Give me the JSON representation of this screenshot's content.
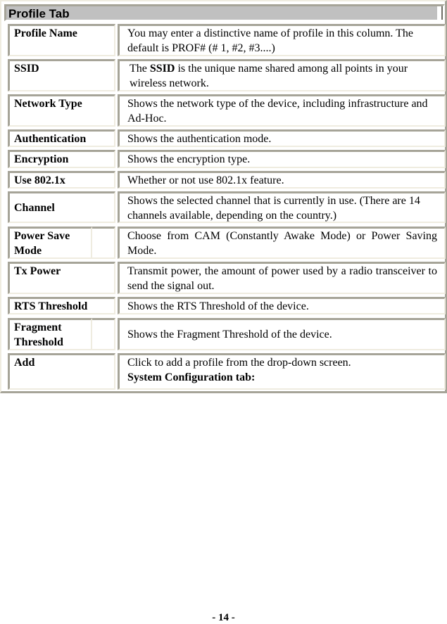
{
  "section_title": "Profile Tab",
  "rows": [
    {
      "label": "Profile Name",
      "description": "You may enter a distinctive name of profile in this column. The default is PROF# (# 1, #2, #3....)"
    },
    {
      "label": "SSID",
      "description_prefix": "The ",
      "description_bold": "SSID",
      "description_suffix": " is the unique name shared among all points in your wireless network."
    },
    {
      "label": "Network Type",
      "description": "Shows the network type of the device, including infrastructure and Ad-Hoc."
    },
    {
      "label": "Authentication",
      "description": "Shows the authentication mode."
    },
    {
      "label": "Encryption",
      "description": "Shows the encryption type."
    },
    {
      "label": "Use 802.1x",
      "description": "Whether or not use 802.1x feature."
    },
    {
      "label": "Channel",
      "description": "Shows the selected channel that is currently in use. (There are 14 channels available, depending on the country.)"
    },
    {
      "label": "Power Save Mode",
      "description": "Choose from CAM (Constantly Awake Mode) or Power Saving Mode."
    },
    {
      "label": "Tx Power",
      "description": "Transmit power, the amount of power used by a radio transceiver to send the signal out."
    },
    {
      "label": "RTS Threshold",
      "description": "Shows the RTS Threshold of the device."
    },
    {
      "label": "Fragment Threshold",
      "description": "Shows the Fragment Threshold of the device."
    },
    {
      "label": "Add",
      "description": "Click to add a profile from the drop-down screen.",
      "description_bold_line": "System Configuration tab:"
    }
  ],
  "page_number": "- 14 -"
}
